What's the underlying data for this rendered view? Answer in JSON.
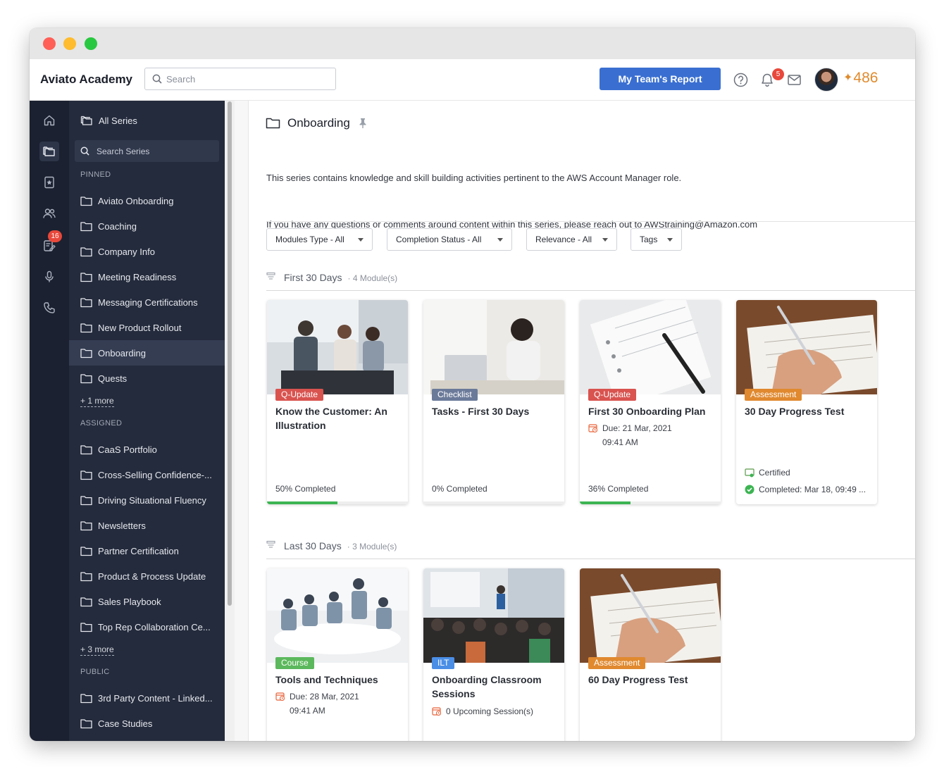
{
  "app": {
    "brand": "Aviato Academy",
    "search_placeholder": "Search",
    "report_button": "My Team's Report",
    "notification_count": "5",
    "points": "486"
  },
  "rail": {
    "badge_count": "16",
    "items": [
      "home-icon",
      "series-icon",
      "bookmark-star-icon",
      "team-icon",
      "assignments-icon",
      "microphone-icon",
      "phone-icon"
    ]
  },
  "sidebar": {
    "all_series": "All Series",
    "search_placeholder": "Search Series",
    "pinned_label": "PINNED",
    "pinned": [
      "Aviato Onboarding",
      "Coaching",
      "Company Info",
      "Meeting Readiness",
      "Messaging Certifications",
      "New Product Rollout",
      "Onboarding",
      "Quests"
    ],
    "pinned_more": "+ 1 more",
    "assigned_label": "ASSIGNED",
    "assigned": [
      "CaaS Portfolio",
      "Cross-Selling Confidence-...",
      "Driving Situational Fluency",
      "Newsletters",
      "Partner Certification",
      "Product & Process Update",
      "Sales Playbook",
      "Top Rep Collaboration Ce..."
    ],
    "assigned_more": "+ 3 more",
    "public_label": "PUBLIC",
    "public": [
      "3rd Party Content - Linked...",
      "Case Studies"
    ]
  },
  "main": {
    "title": "Onboarding",
    "description_1": "This series contains knowledge and skill building activities pertinent to the AWS Account Manager role.",
    "description_2": "If you have any questions or comments around content within this series, please reach out to AWStraining@Amazon.com",
    "filters": [
      "Modules Type - All",
      "Completion Status - All",
      "Relevance - All",
      "Tags"
    ],
    "groups": [
      {
        "title": "First 30 Days",
        "count": "4 Module(s)",
        "cards": [
          {
            "tag": "Q-Update",
            "tag_color": "#d9534f",
            "title": "Know the Customer: An Illustration",
            "progress_text": "50%  Completed",
            "progress": 0.5
          },
          {
            "tag": "Checklist",
            "tag_color": "#6b7a99",
            "title": "Tasks - First 30 Days",
            "progress_text": "0%  Completed",
            "progress": 0
          },
          {
            "tag": "Q-Update",
            "tag_color": "#d9534f",
            "title": "First 30 Onboarding Plan",
            "due_line1": "Due: 21 Mar, 2021",
            "due_line2": "09:41 AM",
            "progress_text": "36%  Completed",
            "progress": 0.36
          },
          {
            "tag": "Assessment",
            "tag_color": "#e0892f",
            "title": "30 Day Progress Test",
            "certified": "Certified",
            "completed": "Completed: Mar 18, 09:49 ..."
          }
        ]
      },
      {
        "title": "Last 30 Days",
        "count": "3 Module(s)",
        "cards": [
          {
            "tag": "Course",
            "tag_color": "#5cb85c",
            "title": "Tools and Techniques",
            "due_line1": "Due: 28 Mar, 2021",
            "due_line2": "09:41 AM"
          },
          {
            "tag": "ILT",
            "tag_color": "#4a8ee6",
            "title": "Onboarding Classroom Sessions",
            "sessions": "0 Upcoming Session(s)"
          },
          {
            "tag": "Assessment",
            "tag_color": "#e0892f",
            "title": "60 Day Progress Test"
          }
        ]
      }
    ]
  }
}
